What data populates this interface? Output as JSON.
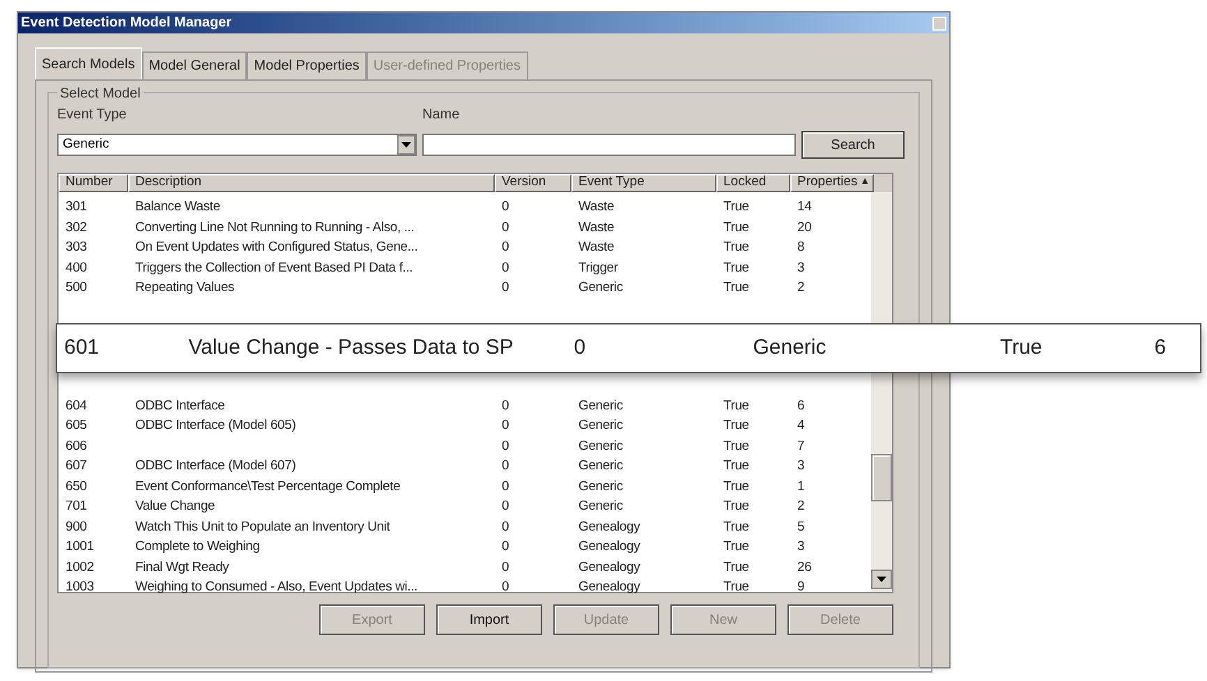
{
  "window": {
    "title": "Event Detection Model Manager"
  },
  "tabs": [
    {
      "label": "Search Models",
      "selected": true,
      "disabled": false
    },
    {
      "label": "Model General",
      "selected": false,
      "disabled": false
    },
    {
      "label": "Model Properties",
      "selected": false,
      "disabled": false
    },
    {
      "label": "User-defined Properties",
      "selected": false,
      "disabled": true
    }
  ],
  "group": {
    "title": "Select Model"
  },
  "event_type": {
    "label": "Event Type",
    "value": "Generic"
  },
  "name": {
    "label": "Name"
  },
  "search_button": "Search",
  "table": {
    "columns": [
      "Number",
      "Description",
      "Version",
      "Event Type",
      "Locked",
      "Properties"
    ],
    "sort_marker": "▲",
    "rows_above": [
      {
        "cells": [
          "301",
          "Balance Waste",
          "0",
          "Waste",
          "True",
          "14"
        ]
      },
      {
        "cells": [
          "302",
          "Converting Line Not Running to Running - Also, ...",
          "0",
          "Waste",
          "True",
          "20"
        ]
      },
      {
        "cells": [
          "303",
          "On Event Updates with Configured Status, Gene...",
          "0",
          "Waste",
          "True",
          "8"
        ]
      },
      {
        "cells": [
          "400",
          "Triggers the Collection of Event Based PI Data f...",
          "0",
          "Trigger",
          "True",
          "3"
        ]
      },
      {
        "cells": [
          "500",
          "Repeating Values",
          "0",
          "Generic",
          "True",
          "2"
        ]
      }
    ],
    "rows_below": [
      {
        "cells": [
          "604",
          "ODBC Interface",
          "0",
          "Generic",
          "True",
          "6"
        ]
      },
      {
        "cells": [
          "605",
          "ODBC Interface (Model 605)",
          "0",
          "Generic",
          "True",
          "4"
        ]
      },
      {
        "cells": [
          "606",
          "",
          "0",
          "Generic",
          "True",
          "7"
        ]
      },
      {
        "cells": [
          "607",
          "ODBC Interface (Model 607)",
          "0",
          "Generic",
          "True",
          "3"
        ]
      },
      {
        "cells": [
          "650",
          "Event Conformance\\Test Percentage Complete",
          "0",
          "Generic",
          "True",
          "1"
        ]
      },
      {
        "cells": [
          "701",
          "Value Change",
          "0",
          "Generic",
          "True",
          "2"
        ]
      },
      {
        "cells": [
          "900",
          "Watch This Unit to Populate an Inventory Unit",
          "0",
          "Genealogy",
          "True",
          "5"
        ]
      },
      {
        "cells": [
          "1001",
          "Complete to Weighing",
          "0",
          "Genealogy",
          "True",
          "3"
        ]
      },
      {
        "cells": [
          "1002",
          "Final Wgt Ready",
          "0",
          "Genealogy",
          "True",
          "26"
        ]
      },
      {
        "cells": [
          "1003",
          "Weighing to Consumed - Also, Event Updates wi...",
          "0",
          "Genealogy",
          "True",
          "9"
        ]
      }
    ]
  },
  "callout": {
    "cells": [
      "601",
      "Value Change - Passes Data to SP",
      "0",
      "Generic",
      "True",
      "6"
    ]
  },
  "buttons": [
    {
      "label": "Export",
      "disabled": true
    },
    {
      "label": "Import",
      "disabled": false
    },
    {
      "label": "Update",
      "disabled": true
    },
    {
      "label": "New",
      "disabled": true
    },
    {
      "label": "Delete",
      "disabled": true
    }
  ]
}
